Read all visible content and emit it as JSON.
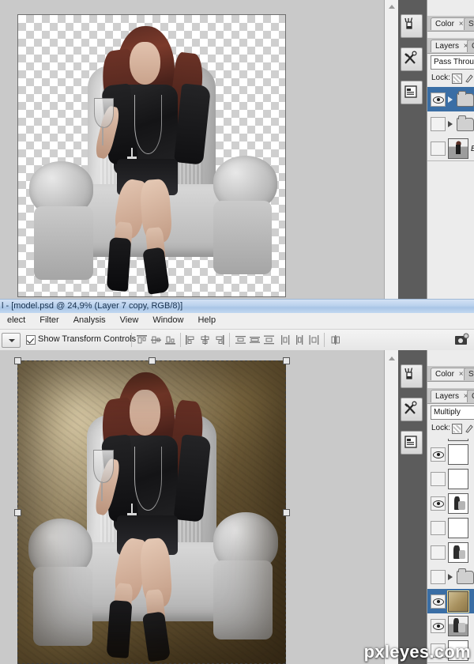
{
  "window": {
    "title": "l - [model.psd @ 24,9% (Layer 7 copy, RGB/8)]",
    "zoom": "24,9%",
    "document_name": "model.psd",
    "active_layer": "Layer 7 copy",
    "color_mode": "RGB/8"
  },
  "menubar": {
    "items": [
      {
        "label": "elect"
      },
      {
        "label": "Filter"
      },
      {
        "label": "Analysis"
      },
      {
        "label": "View"
      },
      {
        "label": "Window"
      },
      {
        "label": "Help"
      }
    ]
  },
  "options_bar": {
    "tool_preset_caret": "chevron-down-icon",
    "show_transform_controls": {
      "label": "Show Transform Controls",
      "checked": true
    },
    "align_icons": [
      "align-top-edges-icon",
      "align-vertical-centers-icon",
      "align-bottom-edges-icon",
      "align-left-edges-icon",
      "align-horizontal-centers-icon",
      "align-right-edges-icon",
      "distribute-top-edges-icon",
      "distribute-vertical-centers-icon",
      "distribute-bottom-edges-icon",
      "distribute-left-edges-icon",
      "distribute-horizontal-centers-icon",
      "distribute-right-edges-icon",
      "auto-align-layers-icon"
    ],
    "bridge_button": "launch-bridge-icon"
  },
  "dock_buttons": [
    {
      "name": "brushes-panel-icon"
    },
    {
      "name": "tool-presets-panel-icon"
    },
    {
      "name": "histogram-panel-icon"
    }
  ],
  "top_panel": {
    "tabs_upper": [
      {
        "label": "Color",
        "active": true,
        "closable": true
      },
      {
        "label": "Sw",
        "active": false,
        "closable": false
      }
    ],
    "tabs_lower": [
      {
        "label": "Layers",
        "active": true,
        "closable": true
      },
      {
        "label": "C",
        "active": false,
        "closable": false
      }
    ],
    "blend_mode": "Pass Through",
    "lock_label": "Lock:",
    "layers": [
      {
        "name": "",
        "visible": true,
        "selected": true,
        "type": "group",
        "expanded": false
      },
      {
        "name": "",
        "visible": false,
        "selected": false,
        "type": "group",
        "expanded": false
      },
      {
        "name": "Ba",
        "visible": false,
        "selected": false,
        "type": "image",
        "thumb": "model"
      }
    ]
  },
  "bottom_panel": {
    "tabs_upper": [
      {
        "label": "Color",
        "active": true,
        "closable": true
      },
      {
        "label": "Sw",
        "active": false,
        "closable": false
      }
    ],
    "tabs_lower": [
      {
        "label": "Layers",
        "active": true,
        "closable": true
      },
      {
        "label": "C",
        "active": false,
        "closable": false
      }
    ],
    "blend_mode": "Multiply",
    "lock_label": "Lock:",
    "layers": [
      {
        "visible": true,
        "selected": false,
        "type": "image",
        "thumb": "transparent"
      },
      {
        "visible": false,
        "selected": false,
        "type": "image",
        "thumb": "transparent"
      },
      {
        "visible": true,
        "selected": false,
        "type": "image",
        "thumb": "model"
      },
      {
        "visible": false,
        "selected": false,
        "type": "image",
        "thumb": "transparent"
      },
      {
        "visible": false,
        "selected": false,
        "type": "image",
        "thumb": "model"
      },
      {
        "visible": false,
        "selected": false,
        "type": "group",
        "thumb": ""
      },
      {
        "visible": true,
        "selected": true,
        "type": "image",
        "thumb": "texture"
      },
      {
        "visible": true,
        "selected": false,
        "type": "image",
        "thumb": "model"
      }
    ]
  },
  "watermark": {
    "text": "pxleyes.com"
  }
}
